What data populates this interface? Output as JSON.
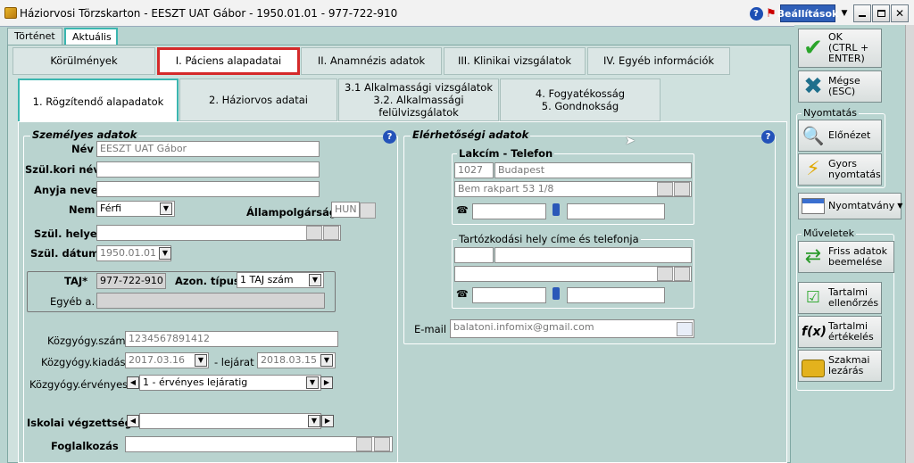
{
  "window": {
    "title": "Háziorvosi Törzskarton - EESZT UAT Gábor - 1950.01.01 - 977-722-910",
    "settings_label": "Beállítások",
    "help": "?"
  },
  "main_tabs": [
    "Történet",
    "Aktuális"
  ],
  "tabs_level1": [
    "Körülmények",
    "I. Páciens alapadatai",
    "II. Anamnézis adatok",
    "III. Klinikai vizsgálatok",
    "IV. Egyéb információk"
  ],
  "tabs_level2": [
    {
      "line1": "1. Rögzítendő alapadatok",
      "line2": ""
    },
    {
      "line1": "2. Háziorvos adatai",
      "line2": ""
    },
    {
      "line1": "3.1 Alkalmassági vizsgálatok",
      "line2": "3.2. Alkalmassági felülvizsgálatok"
    },
    {
      "line1": "4. Fogyatékosság",
      "line2": "5. Gondnokság"
    }
  ],
  "personal": {
    "section_title": "Személyes adatok",
    "name_label": "Név",
    "name_value": "EESZT UAT Gábor",
    "birthname_label": "Szül.kori név",
    "birthname_value": "",
    "mother_label": "Anyja neve",
    "mother_value": "",
    "gender_label": "Nem",
    "gender_value": "Férfi",
    "citizenship_label": "Állampolgárság",
    "citizenship_value": "HUN",
    "birthplace_label": "Szül. helye",
    "birthplace_value": "",
    "birthdate_label": "Szül. dátum",
    "birthdate_value": "1950.01.01",
    "taj_label": "TAJ*",
    "taj_value": "977-722-910",
    "id_type_label": "Azon. típus",
    "id_type_value": "1 TAJ szám",
    "other_label": "Egyéb a.",
    "kozgyogy_label": "Közgyógy.szám",
    "kozgyogy_value": "1234567891412",
    "kozgyogy_issue_label": "Közgyógy.kiadás",
    "kozgyogy_issue_value": "2017.03.16",
    "expiry_label": "- lejárat",
    "expiry_value": "2018.03.15",
    "kozgyogy_valid_label": "Közgyógy.érvényes",
    "kozgyogy_valid_value": "1 - érvényes lejáratig",
    "education_label": "Iskolai végzettség",
    "education_value": "",
    "occupation_label": "Foglalkozás",
    "occupation_value": ""
  },
  "contact": {
    "section_title": "Elérhetőségi adatok",
    "address_title": "Lakcím - Telefon",
    "zip": "1027",
    "city": "Budapest",
    "street": "Bem rakpart 53 1/8",
    "temp_title": "Tartózkodási hely címe és telefonja",
    "email_label": "E-mail",
    "email_value": "balatoni.infomix@gmail.com"
  },
  "sidebar": {
    "ok_label": "OK\n(CTRL +\nENTER)",
    "cancel_label": "Mégse\n(ESC)",
    "print_group": "Nyomtatás",
    "preview_label": "Előnézet",
    "quick_print_label": "Gyors\nnyomtatás",
    "forms_label": "Nyomtatvány",
    "ops_group": "Műveletek",
    "refresh_label": "Friss adatok\nbeemelése",
    "content_check_label": "Tartalmi\nellenőrzés",
    "content_eval_label": "Tartalmi\nértékelés",
    "close_label": "Szakmai\nlezárás"
  }
}
